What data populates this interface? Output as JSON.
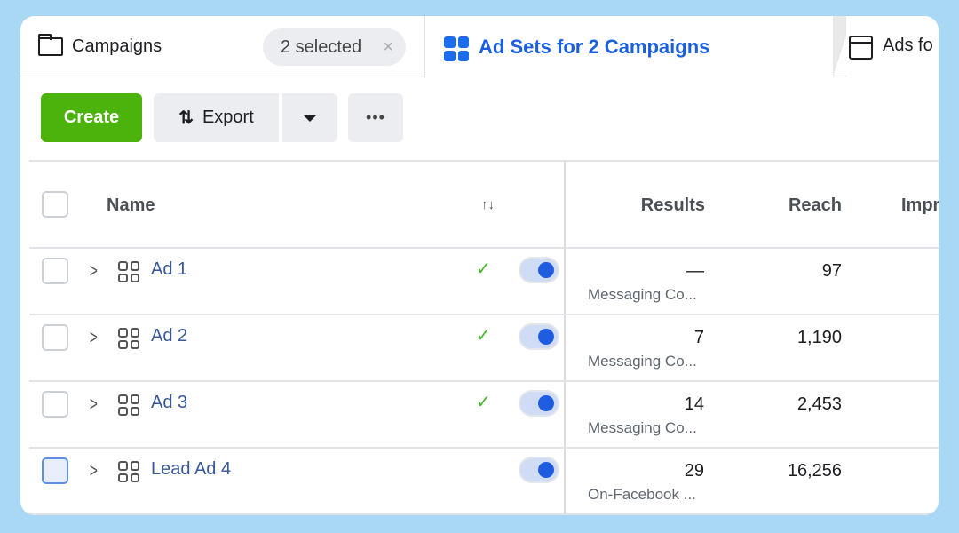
{
  "tabs": {
    "campaigns": "Campaigns",
    "selected": "2 selected",
    "clear": "×",
    "adsets": "Ad Sets for 2 Campaigns",
    "ads": "Ads fo"
  },
  "toolbar": {
    "create": "Create",
    "export": "Export",
    "more": "•••"
  },
  "columns": {
    "name": "Name",
    "sort": "↑↓",
    "results": "Results",
    "reach": "Reach",
    "impressions": "Impr"
  },
  "rows": [
    {
      "name": "Ad 1",
      "status": "✓",
      "results": "—",
      "result_type": "Messaging Co...",
      "reach": "97",
      "active": true
    },
    {
      "name": "Ad 2",
      "status": "✓",
      "results": "7",
      "result_type": "Messaging Co...",
      "reach": "1,190",
      "active": true
    },
    {
      "name": "Ad 3",
      "status": "✓",
      "results": "14",
      "result_type": "Messaging Co...",
      "reach": "2,453",
      "active": true
    },
    {
      "name": "Lead Ad 4",
      "status": "",
      "results": "29",
      "result_type": "On-Facebook ...",
      "reach": "16,256",
      "active": true
    }
  ],
  "colors": {
    "create": "#4bb30c",
    "accent": "#1a5fe0",
    "link": "#385898",
    "background": "#a9d8f4"
  }
}
